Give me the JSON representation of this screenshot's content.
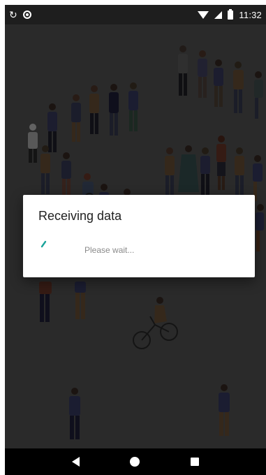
{
  "status_bar": {
    "time": "11:32",
    "icons": [
      "sync-icon",
      "circle-icon",
      "wifi-icon",
      "signal-icon",
      "battery-icon"
    ]
  },
  "dialog": {
    "title": "Receiving data",
    "message": "Please wait...",
    "spinner_color": "#1aa39a"
  },
  "nav_bar": {
    "icons": [
      "back-icon",
      "home-icon",
      "recents-icon"
    ]
  },
  "colors": {
    "scrim": "#5d5d5d",
    "status_bar": "#1e1e1e",
    "nav_bar": "#000000",
    "dialog_bg": "#ffffff"
  }
}
